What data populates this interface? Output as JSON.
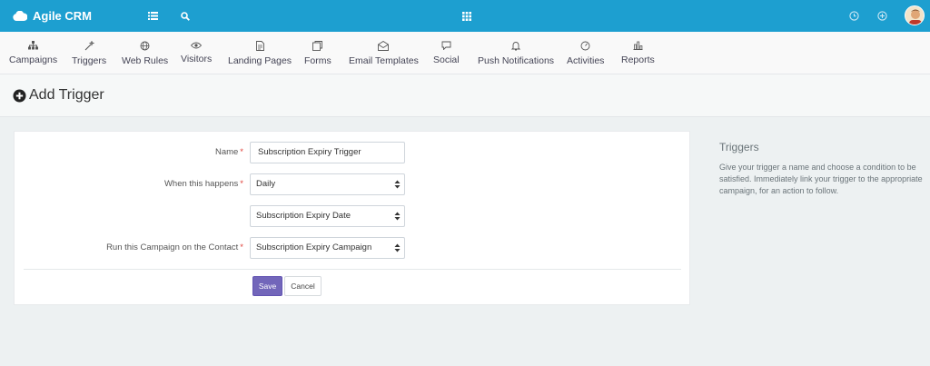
{
  "app": {
    "name": "Agile CRM"
  },
  "colors": {
    "topbar": "#1d9fd0",
    "accent_button": "#7266ba",
    "required": "#e0433c"
  },
  "topbar_icons": [
    "cloud-icon",
    "list-icon",
    "search-icon",
    "grid-icon",
    "clock-icon",
    "add-circle-icon",
    "avatar"
  ],
  "menu": [
    {
      "label": "Campaigns",
      "icon": "sitemap-icon"
    },
    {
      "label": "Triggers",
      "icon": "magic-wand-icon"
    },
    {
      "label": "Web Rules",
      "icon": "globe-icon"
    },
    {
      "label": "Visitors",
      "icon": "eye-icon"
    },
    {
      "label": "Landing Pages",
      "icon": "document-icon"
    },
    {
      "label": "Forms",
      "icon": "forms-icon"
    },
    {
      "label": "Email Templates",
      "icon": "email-icon"
    },
    {
      "label": "Social",
      "icon": "chat-icon"
    },
    {
      "label": "Push Notifications",
      "icon": "bell-icon"
    },
    {
      "label": "Activities",
      "icon": "gauge-icon"
    },
    {
      "label": "Reports",
      "icon": "bar-chart-icon"
    }
  ],
  "page": {
    "title": "Add Trigger"
  },
  "form": {
    "name_label": "Name",
    "name_value": "Subscription Expiry Trigger",
    "when_label": "When this happens",
    "when_value": "Daily",
    "condition_value": "Subscription Expiry Date",
    "campaign_label": "Run this Campaign on the Contact",
    "campaign_value": "Subscription Expiry Campaign",
    "required_mark": "*",
    "save_label": "Save",
    "cancel_label": "Cancel"
  },
  "help": {
    "title": "Triggers",
    "text": "Give your trigger a name and choose a condition to be satisfied. Immediately link your trigger to the appropriate campaign, for an action to follow."
  }
}
